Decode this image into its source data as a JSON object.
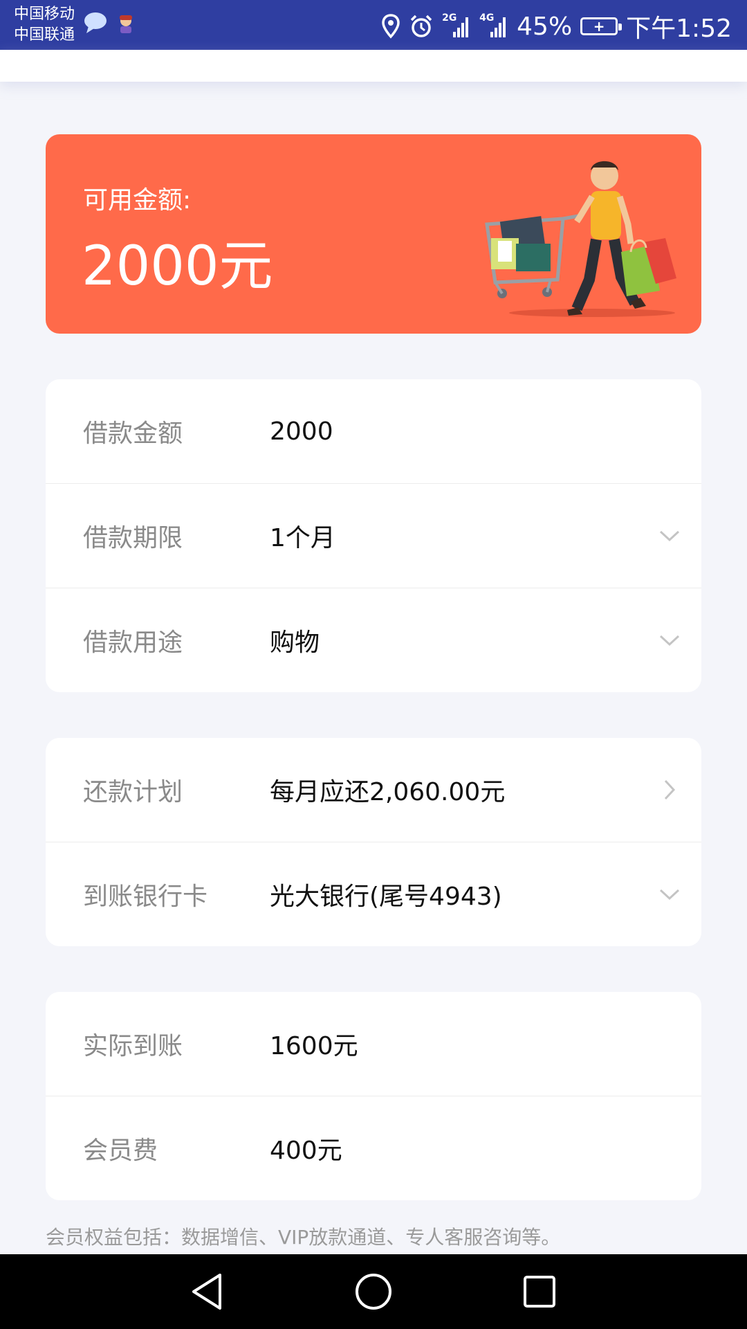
{
  "status_bar": {
    "carrier_1": "中国移动",
    "carrier_2": "中国联通",
    "battery": "45%",
    "time": "下午1:52",
    "network_1": "2G",
    "network_2": "4G",
    "icons": [
      "message-icon",
      "avatar-icon",
      "location-icon",
      "alarm-icon",
      "signal-icon",
      "signal-icon",
      "battery-charging-icon"
    ]
  },
  "banner": {
    "label": "可用金额:",
    "amount": "2000元",
    "bg_color": "#ff6a4a"
  },
  "loan_form": {
    "rows": [
      {
        "label": "借款金额",
        "value": "2000"
      },
      {
        "label": "借款期限",
        "value": "1个月"
      },
      {
        "label": "借款用途",
        "value": "购物"
      }
    ]
  },
  "repay_card": {
    "rows": [
      {
        "label": "还款计划",
        "value": "每月应还2,060.00元"
      },
      {
        "label": "到账银行卡",
        "value": "光大银行(尾号4943)"
      }
    ]
  },
  "summary_card": {
    "rows": [
      {
        "label": "实际到账",
        "value": "1600元"
      },
      {
        "label": "会员费",
        "value": "400元"
      }
    ]
  },
  "note": "会员权益包括：数据增信、VIP放款通道、专人客服咨询等。",
  "nav_bar": {
    "icons": [
      "back-icon",
      "home-icon",
      "recents-icon"
    ]
  }
}
